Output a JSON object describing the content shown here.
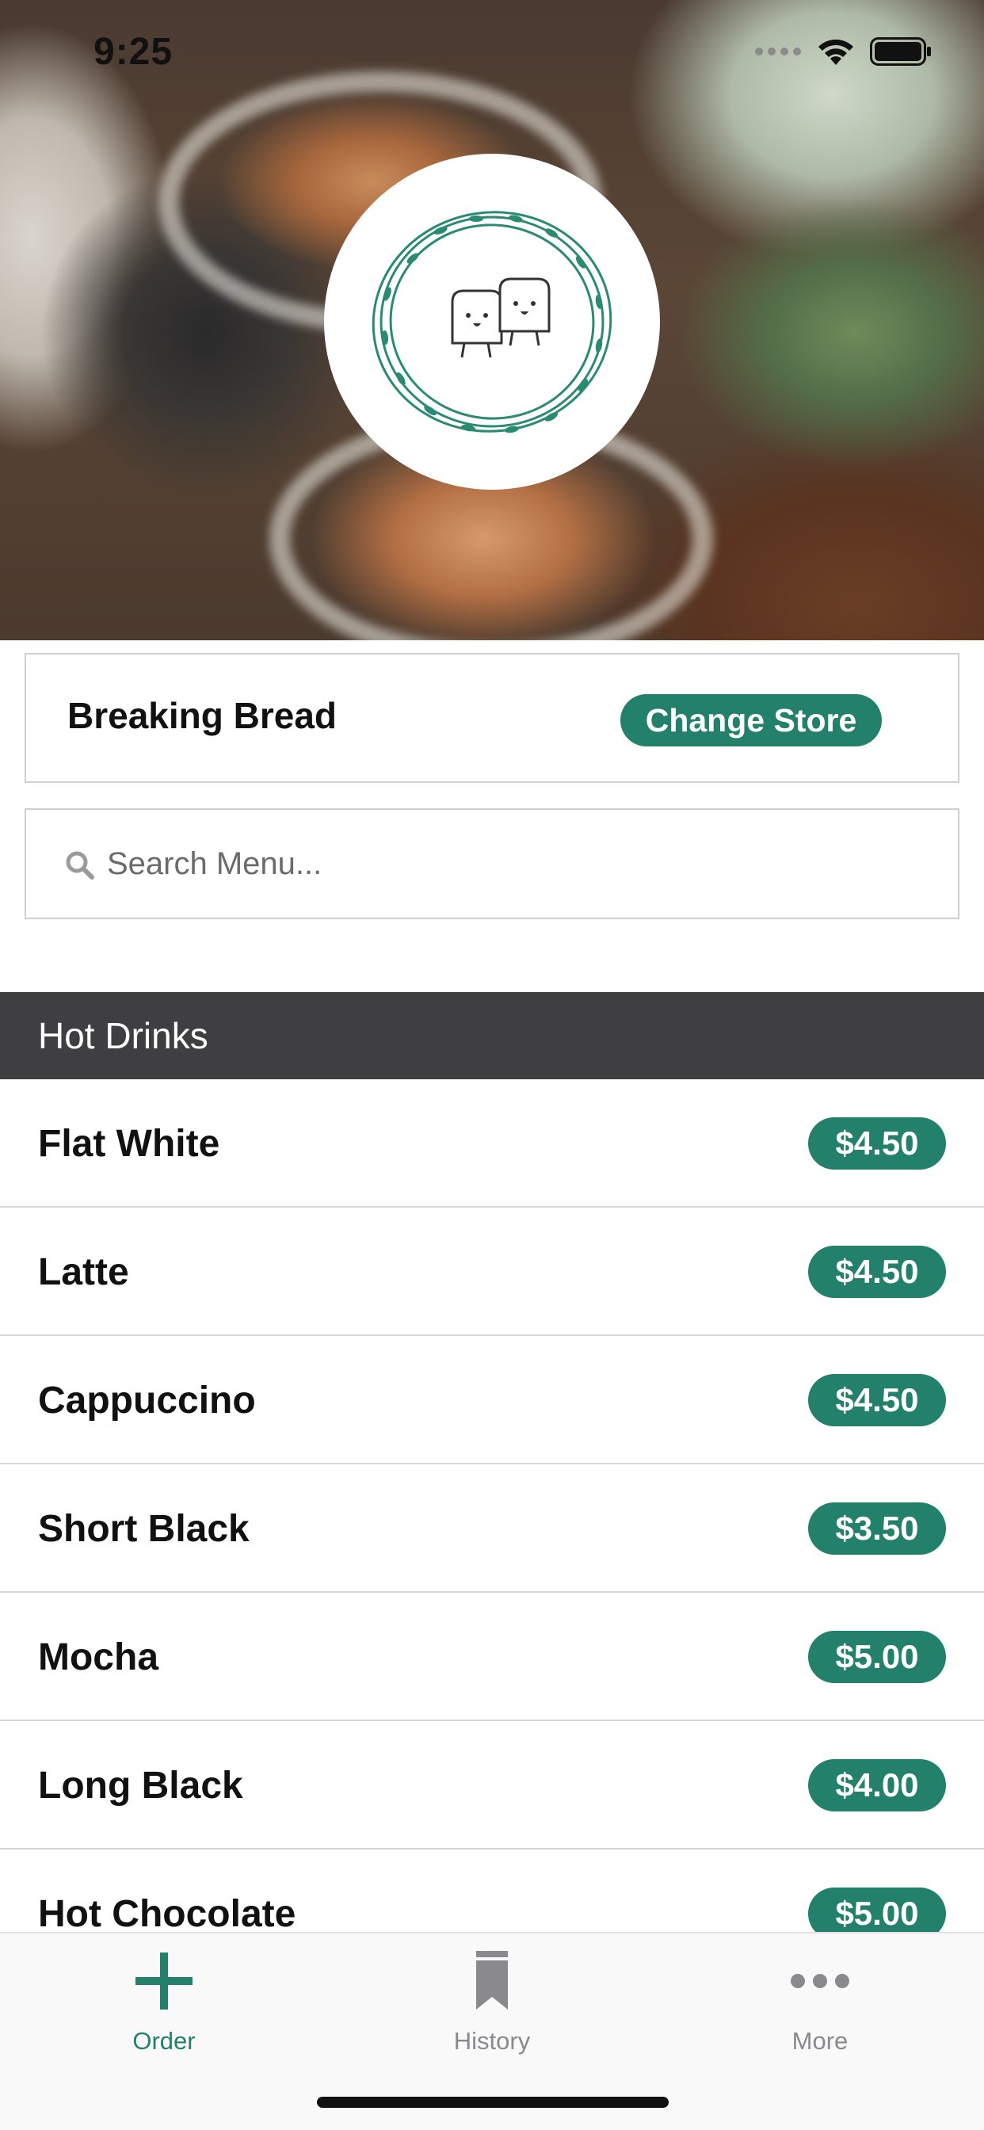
{
  "status_bar": {
    "time": "9:25"
  },
  "store": {
    "name": "Breaking Bread",
    "change_label": "Change Store"
  },
  "search": {
    "placeholder": "Search Menu..."
  },
  "section": {
    "title": "Hot Drinks"
  },
  "menu_items": [
    {
      "name": "Flat White",
      "price": "$4.50"
    },
    {
      "name": "Latte",
      "price": "$4.50"
    },
    {
      "name": "Cappuccino",
      "price": "$4.50"
    },
    {
      "name": "Short Black",
      "price": "$3.50"
    },
    {
      "name": "Mocha",
      "price": "$5.00"
    },
    {
      "name": "Long Black",
      "price": "$4.00"
    },
    {
      "name": "Hot Chocolate",
      "price": "$5.00"
    }
  ],
  "tab_bar": {
    "tabs": [
      {
        "label": "Order",
        "icon": "plus-icon",
        "active": true
      },
      {
        "label": "History",
        "icon": "bookmark-icon",
        "active": false
      },
      {
        "label": "More",
        "icon": "ellipsis-icon",
        "active": false
      }
    ]
  },
  "colors": {
    "accent": "#23806a",
    "section_header": "#3f3f42",
    "inactive_tab": "#8a8a8e"
  }
}
